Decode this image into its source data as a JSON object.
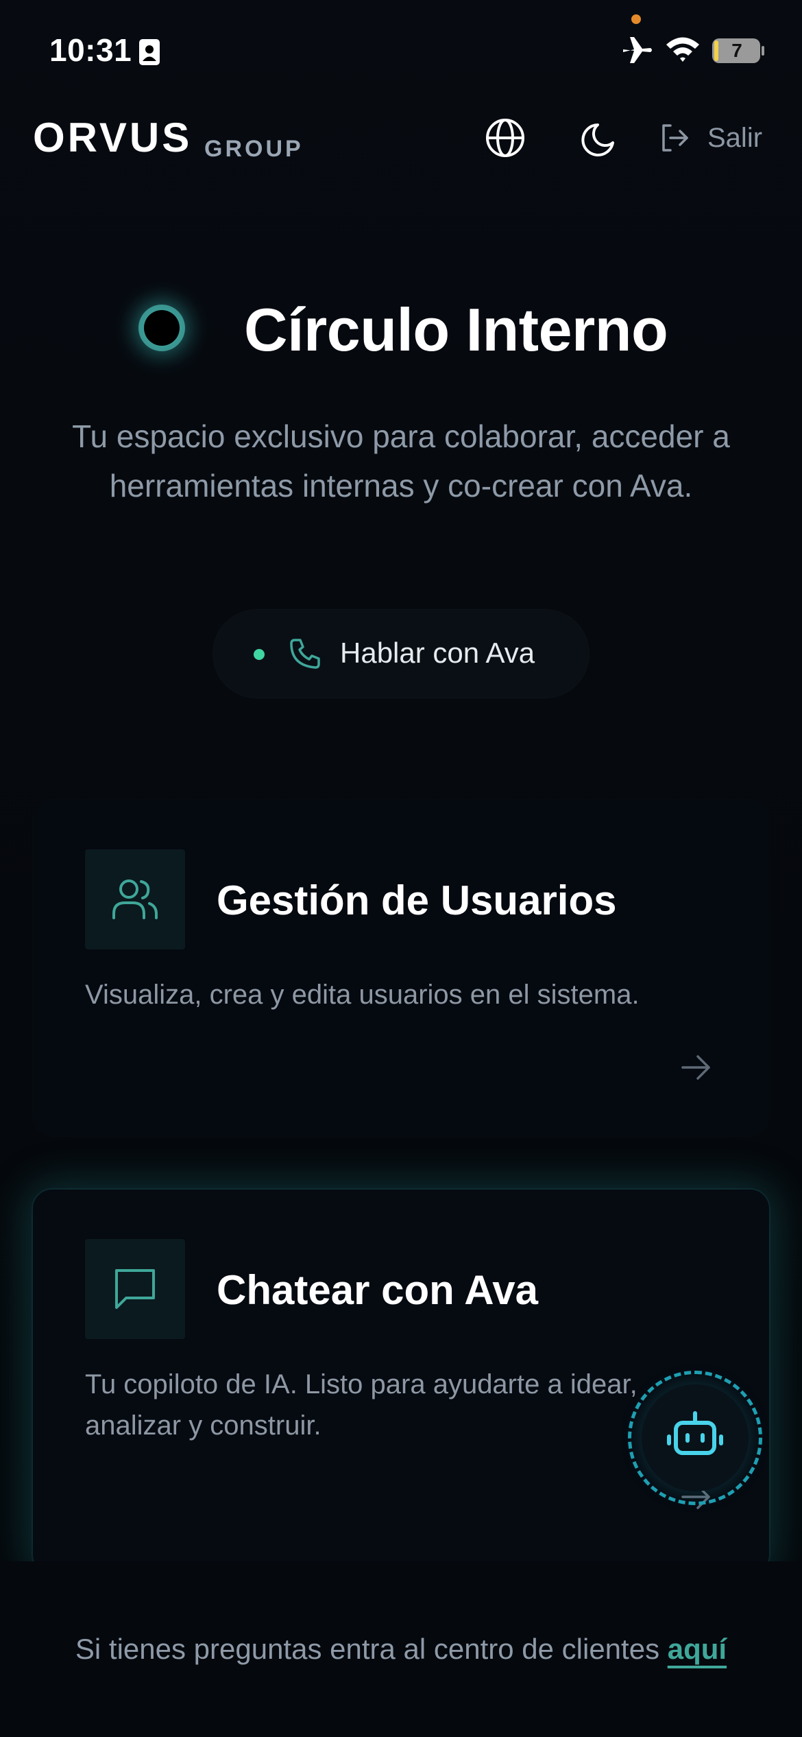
{
  "status_bar": {
    "time": "10:31",
    "battery": "7"
  },
  "header": {
    "logo_main": "ORVUS",
    "logo_sub": "GROUP",
    "logout_label": "Salir"
  },
  "hero": {
    "title": "Círculo Interno",
    "subtitle": "Tu espacio exclusivo para colaborar, acceder a herramientas internas y co-crear con Ava."
  },
  "talk_button": {
    "label": "Hablar con Ava",
    "status_color": "#3fd6a1"
  },
  "cards": [
    {
      "title": "Gestión de Usuarios",
      "description": "Visualiza, crea y edita usuarios en el sistema.",
      "icon": "users-icon"
    },
    {
      "title": "Chatear con Ava",
      "description": "Tu copiloto de IA. Listo para ayudarte a idear, analizar y construir.",
      "icon": "chat-bubble-icon"
    }
  ],
  "footer": {
    "text": "Si tienes preguntas entra al centro de clientes ",
    "link_label": "aquí"
  },
  "colors": {
    "accent": "#3fa79a",
    "background": "#05080d",
    "glow": "#2ab4b4"
  }
}
